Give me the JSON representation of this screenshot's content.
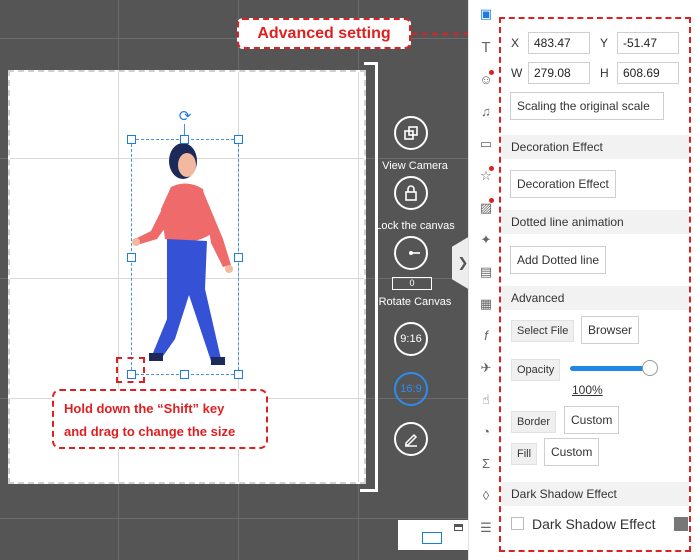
{
  "annotations": {
    "advanced_setting": "Advanced setting",
    "shift_tip_line1": "Hold down the “Shift” key",
    "shift_tip_line2": "and drag to change the size"
  },
  "toolbar": {
    "view_camera": "View Camera",
    "lock_canvas": "Lock the canvas",
    "rotate_value": "0",
    "rotate_canvas": "Rotate Canvas",
    "ratio_916": "9:16",
    "ratio_169": "16:9"
  },
  "icon_strip": [
    "image-icon",
    "text-icon",
    "character-icon",
    "music-icon",
    "speech-bubble-icon",
    "star-icon",
    "picture-icon",
    "magic-wand-icon",
    "folder-icon",
    "film-icon",
    "formula-icon",
    "airplane-icon",
    "hand-icon",
    "pie-chart-icon",
    "sigma-icon",
    "drop-icon",
    "layers-icon"
  ],
  "properties": {
    "x_label": "X",
    "x_value": "483.47",
    "y_label": "Y",
    "y_value": "-51.47",
    "w_label": "W",
    "w_value": "279.08",
    "h_label": "H",
    "h_value": "608.69",
    "scaling_button": "Scaling the original scale",
    "decoration_section": "Decoration Effect",
    "decoration_button": "Decoration Effect",
    "dotted_section": "Dotted line animation",
    "dotted_button": "Add Dotted line",
    "advanced_section": "Advanced",
    "select_file": "Select File",
    "browser_button": "Browser",
    "opacity_label": "Opacity",
    "opacity_value": "100%",
    "opacity_level": 1.0,
    "border_label": "Border",
    "border_value": "Custom",
    "fill_label": "Fill",
    "fill_value": "Custom",
    "shadow_section": "Dark Shadow Effect",
    "shadow_checkbox_label": "Dark Shadow Effect"
  },
  "colors": {
    "accent": "#1e7be0",
    "annotation_red": "#e02020",
    "workspace_bg": "#555555"
  }
}
